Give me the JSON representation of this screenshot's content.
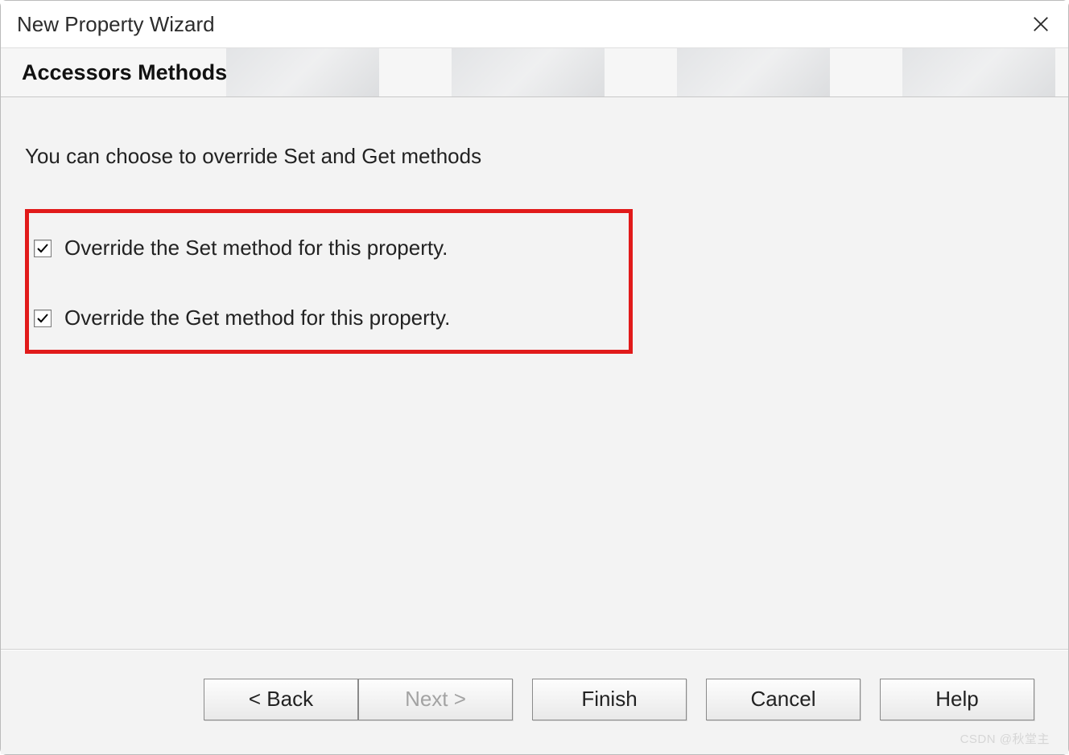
{
  "window": {
    "title": "New Property Wizard"
  },
  "banner": {
    "heading": "Accessors Methods"
  },
  "content": {
    "description": "You can choose to override Set and Get methods",
    "checkboxes": [
      {
        "label": "Override the Set method for this property.",
        "checked": true
      },
      {
        "label": "Override the Get method for this property.",
        "checked": true
      }
    ]
  },
  "buttons": {
    "back": "< Back",
    "next": "Next >",
    "finish": "Finish",
    "cancel": "Cancel",
    "help": "Help"
  },
  "watermark": "CSDN @秋堂主"
}
